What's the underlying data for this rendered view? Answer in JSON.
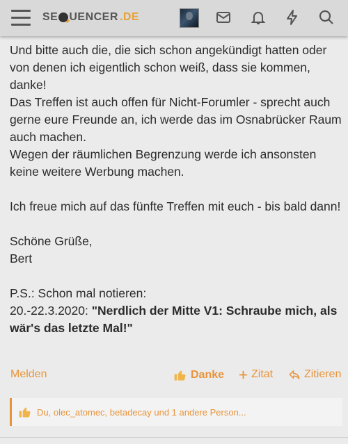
{
  "header": {
    "logo_main": "SE",
    "logo_rest": "UENCER",
    "logo_domain": ".DE",
    "icons": [
      "menu-icon",
      "avatar",
      "envelope-icon",
      "bell-icon",
      "bolt-icon",
      "search-icon"
    ]
  },
  "post": {
    "lines": [
      "Und bitte auch die, die sich schon angekündigt hatten oder von denen ich eigentlich schon weiß, dass sie kommen, danke!",
      "Das Treffen ist auch offen für Nicht-Forumler - sprecht auch gerne eure Freunde an, ich werde das im Osnabrücker Raum auch machen.",
      "Wegen der räumlichen Begrenzung werde ich ansonsten keine weitere Werbung machen.",
      "Ich freue mich auf das fünfte Treffen mit euch - bis bald dann!",
      "Schöne Grüße,",
      "Bert",
      "P.S.: Schon mal notieren:",
      "20.-22.3.2020: ",
      "\"Nerdlich der Mitte V1: Schraube mich, als wär's das letzte Mal!\""
    ]
  },
  "actions": {
    "report": "Melden",
    "thanks": "Danke",
    "quote_add": "Zitat",
    "quote": "Zitieren"
  },
  "reactions": {
    "text": "Du, olec_atomec, betadecay und 1 andere Person..."
  },
  "colors": {
    "accent": "#e8943a",
    "header_bg": "#d9d9d9",
    "page_bg": "#ebebeb"
  }
}
